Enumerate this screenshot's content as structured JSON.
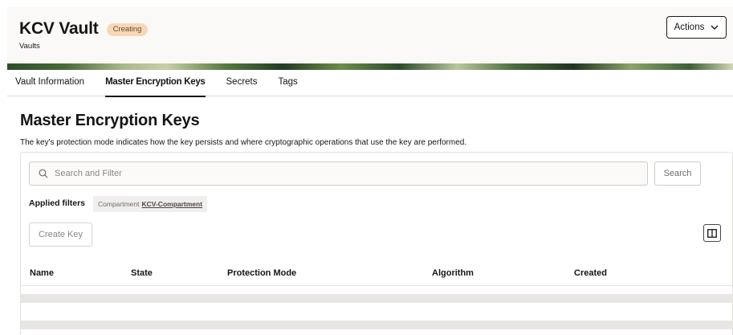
{
  "header": {
    "title": "KCV Vault",
    "status": "Creating",
    "subtitle": "Vaults",
    "actions_label": "Actions"
  },
  "tabs": [
    {
      "label": "Vault Information",
      "active": false
    },
    {
      "label": "Master Encryption Keys",
      "active": true
    },
    {
      "label": "Secrets",
      "active": false
    },
    {
      "label": "Tags",
      "active": false
    }
  ],
  "section": {
    "title": "Master Encryption Keys",
    "description": "The key's protection mode indicates how the key persists and where cryptographic operations that use the key are performed."
  },
  "search": {
    "placeholder": "Search and Filter",
    "value": "",
    "button_label": "Search",
    "icon": "search-icon"
  },
  "filters": {
    "label": "Applied filters",
    "chips": [
      {
        "name": "Compartment",
        "value": "KCV-Compartment"
      }
    ]
  },
  "toolbar": {
    "create_label": "Create Key",
    "columns_icon": "columns-icon"
  },
  "table": {
    "columns": [
      "Name",
      "State",
      "Protection Mode",
      "Algorithm",
      "Created"
    ],
    "rows": []
  },
  "colors": {
    "status_badge_bg": "#f6d7b8",
    "header_bg": "#fbf9f8",
    "skeleton": "#e8e6e3"
  }
}
